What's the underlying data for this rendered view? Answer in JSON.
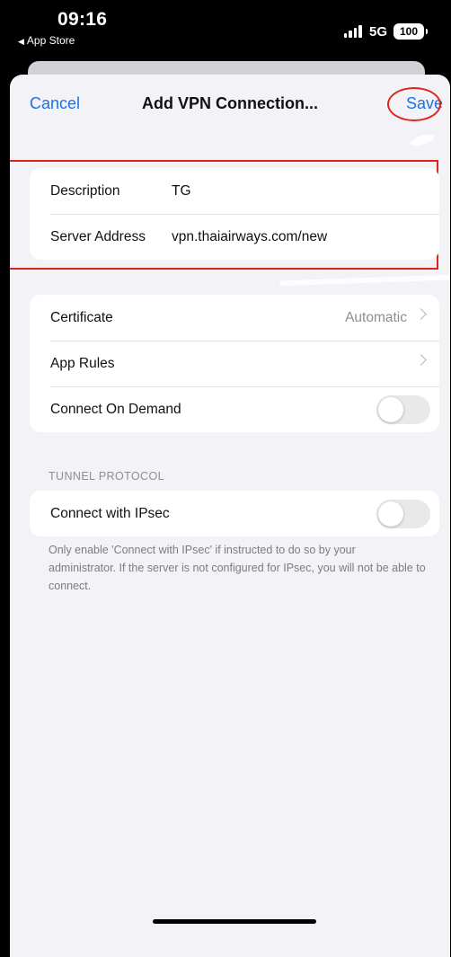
{
  "status_bar": {
    "time": "09:16",
    "back_label": "App Store",
    "network": "5G",
    "battery": "100"
  },
  "nav": {
    "cancel_label": "Cancel",
    "title": "Add VPN Connection...",
    "save_label": "Save"
  },
  "connection": {
    "rows": [
      {
        "label": "Description",
        "value": "TG"
      },
      {
        "label": "Server Address",
        "value": "vpn.thaiairways.com/new"
      }
    ]
  },
  "settings": {
    "certificate": {
      "label": "Certificate",
      "value": "Automatic"
    },
    "app_rules": {
      "label": "App Rules"
    },
    "connect_on_demand": {
      "label": "Connect On Demand",
      "enabled": false
    }
  },
  "tunnel": {
    "header": "TUNNEL PROTOCOL",
    "ipsec": {
      "label": "Connect with IPsec",
      "enabled": false
    },
    "footnote": "Only enable 'Connect with IPsec' if instructed to do so by your administrator. If the server is not configured for IPsec, you will not be able to connect."
  },
  "colors": {
    "accent": "#1a73e8",
    "annotation": "#e0241b",
    "background": "#f2f2f7"
  }
}
